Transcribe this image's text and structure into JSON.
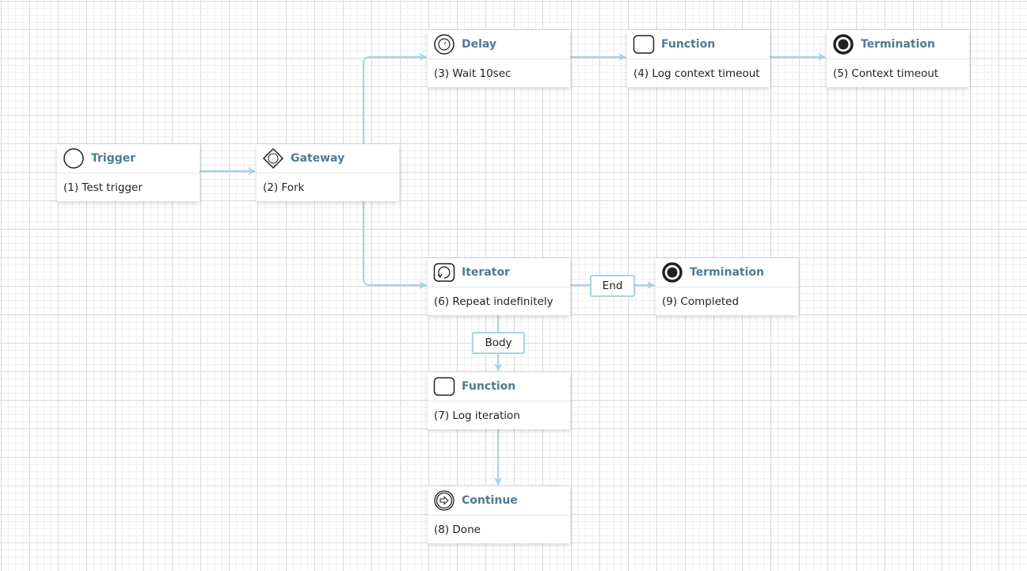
{
  "colors": {
    "edge": "#a7d3e6",
    "node_title": "#4f7b93",
    "node_text": "#222222"
  },
  "nodes": [
    {
      "id": 1,
      "type": "Trigger",
      "label": "(1) Test trigger",
      "icon": "trigger-icon"
    },
    {
      "id": 2,
      "type": "Gateway",
      "label": "(2) Fork",
      "icon": "gateway-icon"
    },
    {
      "id": 3,
      "type": "Delay",
      "label": "(3) Wait 10sec",
      "icon": "delay-timer-icon"
    },
    {
      "id": 4,
      "type": "Function",
      "label": "(4) Log context timeout",
      "icon": "function-icon"
    },
    {
      "id": 5,
      "type": "Termination",
      "label": "(5) Context timeout",
      "icon": "termination-icon"
    },
    {
      "id": 6,
      "type": "Iterator",
      "label": "(6) Repeat indefinitely",
      "icon": "iterator-loop-icon"
    },
    {
      "id": 7,
      "type": "Function",
      "label": "(7) Log iteration",
      "icon": "function-icon"
    },
    {
      "id": 8,
      "type": "Continue",
      "label": "(8) Done",
      "icon": "continue-icon"
    },
    {
      "id": 9,
      "type": "Termination",
      "label": "(9) Completed",
      "icon": "termination-icon"
    }
  ],
  "edges": [
    {
      "from": 1,
      "to": 2,
      "label": ""
    },
    {
      "from": 2,
      "to": 3,
      "label": ""
    },
    {
      "from": 3,
      "to": 4,
      "label": ""
    },
    {
      "from": 4,
      "to": 5,
      "label": ""
    },
    {
      "from": 2,
      "to": 6,
      "label": ""
    },
    {
      "from": 6,
      "to": 9,
      "label": "End"
    },
    {
      "from": 6,
      "to": 7,
      "label": "Body"
    },
    {
      "from": 7,
      "to": 8,
      "label": ""
    }
  ],
  "edge_labels": {
    "end": "End",
    "body": "Body"
  }
}
